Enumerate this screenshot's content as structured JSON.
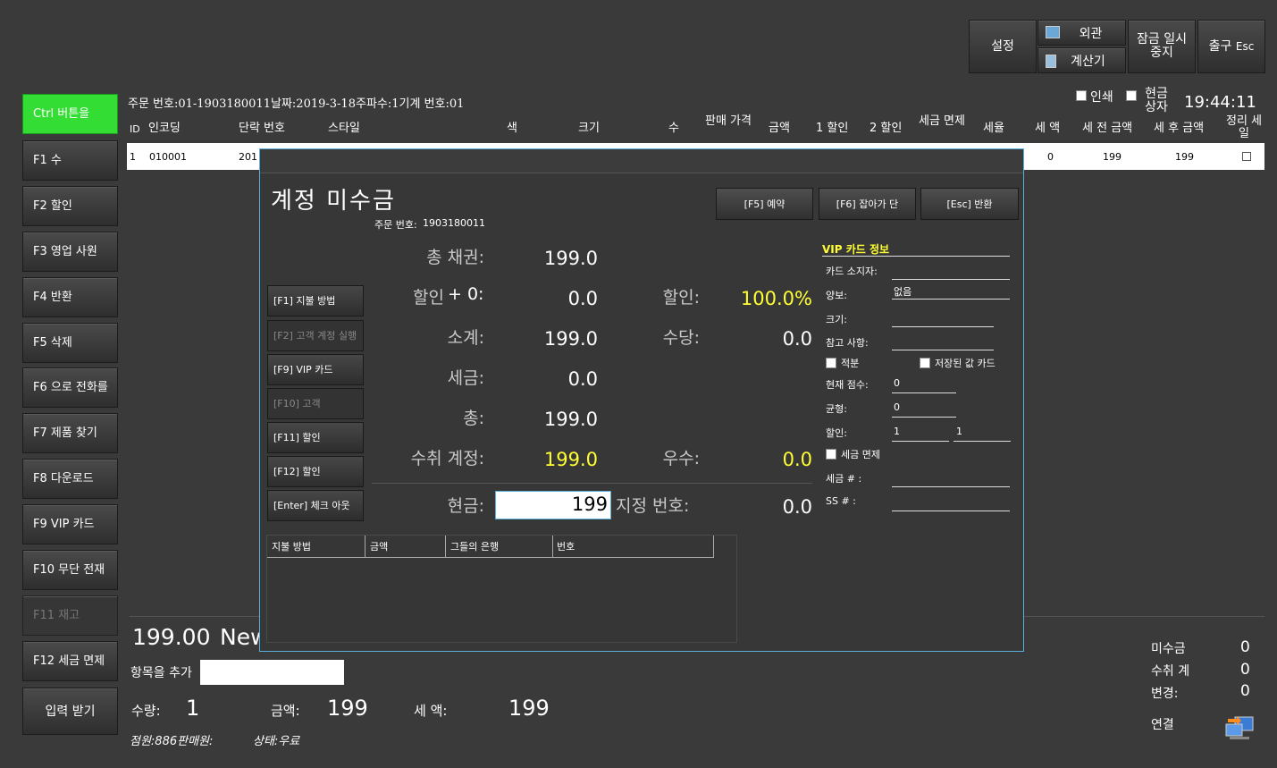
{
  "top_buttons": {
    "settings": "설정",
    "appearance": "외관",
    "calculator": "계산기",
    "lock": "잠금 일시 중지",
    "exit": "출구",
    "exit_key": "Esc"
  },
  "header_info": {
    "order_line": "주문 번호:01-1903180011날짜:2019-3-18주파수:1기계 번호:01",
    "print_label": "인쇄",
    "cash_label": "현금 상자",
    "clock": "19:44:11"
  },
  "sidebar": [
    {
      "label": "Ctrl 버튼을",
      "state": "active"
    },
    {
      "label": "F1 수",
      "state": "normal"
    },
    {
      "label": "F2 할인",
      "state": "normal"
    },
    {
      "label": "F3 영업 사원",
      "state": "normal"
    },
    {
      "label": "F4 반환",
      "state": "normal"
    },
    {
      "label": "F5 삭제",
      "state": "normal"
    },
    {
      "label": "F6 으로 전화를",
      "state": "normal"
    },
    {
      "label": "F7 제품 찾기",
      "state": "normal"
    },
    {
      "label": "F8 다운로드",
      "state": "normal"
    },
    {
      "label": "F9 VIP 카드",
      "state": "normal"
    },
    {
      "label": "F10 무단 전재",
      "state": "normal"
    },
    {
      "label": "F11 재고",
      "state": "disabled"
    },
    {
      "label": "F12 세금 면제",
      "state": "normal"
    },
    {
      "label": "입력 받기",
      "state": "normal"
    }
  ],
  "table": {
    "headers": {
      "id": "ID",
      "code": "인코딩",
      "short_no": "단락 번호",
      "style": "스타일",
      "color": "색",
      "size": "크기",
      "qty": "수",
      "sale_price": "판매 가격",
      "amount": "금액",
      "disc1": "1 할인",
      "disc2": "2 할인",
      "tax_free": "세금 면제",
      "tax_rate": "세율",
      "tax_amount": "세 액",
      "pre_tax": "세 전 금액",
      "post_tax": "세 후 금액",
      "settle": "정리 세일"
    },
    "row": {
      "id": "1",
      "code": "010001",
      "short_no": "201",
      "tax_amount": "0",
      "pre_tax": "199",
      "post_tax": "199"
    }
  },
  "dialog": {
    "title": "계정 미수금",
    "order_no_label": "주문 번호:",
    "order_no": "1903180011",
    "buttons": {
      "reserve": "[F5] 예약",
      "hold": "[F6] 잡아가 단",
      "back": "[Esc] 반환"
    },
    "pay_buttons": [
      {
        "label": "[F1] 지불 방법",
        "state": "normal"
      },
      {
        "label": "[F2] 고객 계정 실행",
        "state": "disabled"
      },
      {
        "label": "[F9] VIP 카드",
        "state": "normal"
      },
      {
        "label": "[F10] 고객",
        "state": "disabled"
      },
      {
        "label": "[F11] 할인",
        "state": "normal"
      },
      {
        "label": "[F12] 할인",
        "state": "normal"
      },
      {
        "label": "[Enter] 체크 아웃",
        "state": "normal"
      }
    ],
    "summary": {
      "total_claim_label": "총 채권:",
      "total_claim": "199.0",
      "discount_label": "할인",
      "discount_plus": "+ 0:",
      "discount": "0.0",
      "discount_pct_label": "할인:",
      "discount_pct": "100.0%",
      "subtotal_label": "소계:",
      "subtotal": "199.0",
      "allowance_label": "수당:",
      "allowance": "0.0",
      "tax_label": "세금:",
      "tax": "0.0",
      "total_label": "총:",
      "total": "199.0",
      "receivable_label": "수취 계정:",
      "receivable": "199.0",
      "excellent_label": "우수:",
      "excellent": "0.0",
      "cash_label": "현금:",
      "cash_value": "199",
      "designated_label": "지정 번호:",
      "designated": "0.0"
    },
    "pay_table_headers": {
      "method": "지불 방법",
      "amount": "금액",
      "bank": "그들의 은행",
      "number": "번호"
    },
    "vip": {
      "title": "VIP 카드 정보",
      "holder_label": "카드 소지자:",
      "yield_label": "양보:",
      "yield_value": "없음",
      "size_label": "크기:",
      "note_label": "참고 사항:",
      "points_chk_label": "적분",
      "stored_chk_label": "저장된 값 카드",
      "current_points_label": "현재 점수:",
      "current_points": "0",
      "balance_label": "균형:",
      "balance": "0",
      "discount_label": "할인:",
      "discount_a": "1",
      "discount_b": "1",
      "tax_free_label": "세금 면제",
      "tax_no_label": "세금 # :",
      "ss_label": "SS # :"
    }
  },
  "bottom": {
    "amount_display": "199.00",
    "currency_partial": "New",
    "add_item_label": "항목을 추가",
    "qty_label": "수량:",
    "qty": "1",
    "amount_label": "금액:",
    "amount": "199",
    "tax_label": "세 액:",
    "tax": "199",
    "status_line_clerk": "점원:886판매원:",
    "status_line_state": "상태:우료"
  },
  "right_summary": {
    "unpaid_label": "미수금",
    "unpaid": "0",
    "received_label": "수취 계",
    "received": "0",
    "change_label": "변경:",
    "change": "0",
    "connect_label": "연결"
  },
  "colors": {
    "accent_green": "#33dd33",
    "yellow": "#ffff33",
    "dialog_border": "#5ab0d8"
  }
}
